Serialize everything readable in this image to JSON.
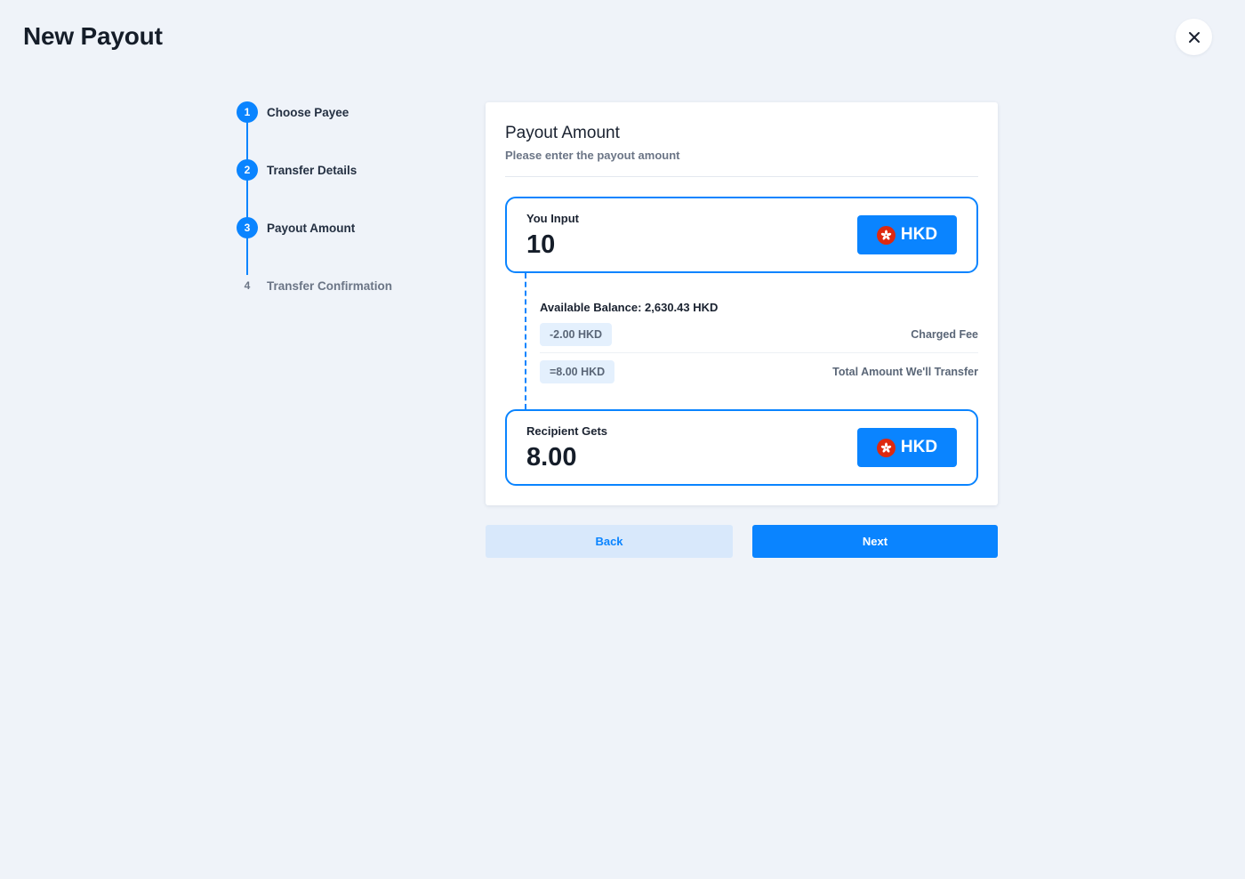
{
  "header": {
    "title": "New Payout",
    "close_icon": "close-icon"
  },
  "stepper": {
    "steps": [
      {
        "number": "1",
        "label": "Choose Payee",
        "state": "completed"
      },
      {
        "number": "2",
        "label": "Transfer Details",
        "state": "completed"
      },
      {
        "number": "3",
        "label": "Payout Amount",
        "state": "active"
      },
      {
        "number": "4",
        "label": "Transfer Confirmation",
        "state": "pending"
      }
    ]
  },
  "card": {
    "title": "Payout Amount",
    "subtitle": "Please enter the payout amount",
    "input": {
      "label": "You Input",
      "value": "10",
      "currency": "HKD",
      "currency_icon": "hong-kong-flag-icon"
    },
    "available_balance": "Available Balance: 2,630.43 HKD",
    "fee": {
      "amount": "-2.00 HKD",
      "label": "Charged Fee"
    },
    "total": {
      "amount": "=8.00 HKD",
      "label": "Total Amount We'll Transfer"
    },
    "recipient": {
      "label": "Recipient Gets",
      "value": "8.00",
      "currency": "HKD",
      "currency_icon": "hong-kong-flag-icon"
    }
  },
  "actions": {
    "back_label": "Back",
    "next_label": "Next"
  },
  "colors": {
    "accent": "#0a84ff",
    "background": "#eff3f9",
    "flag_red": "#de2910"
  }
}
